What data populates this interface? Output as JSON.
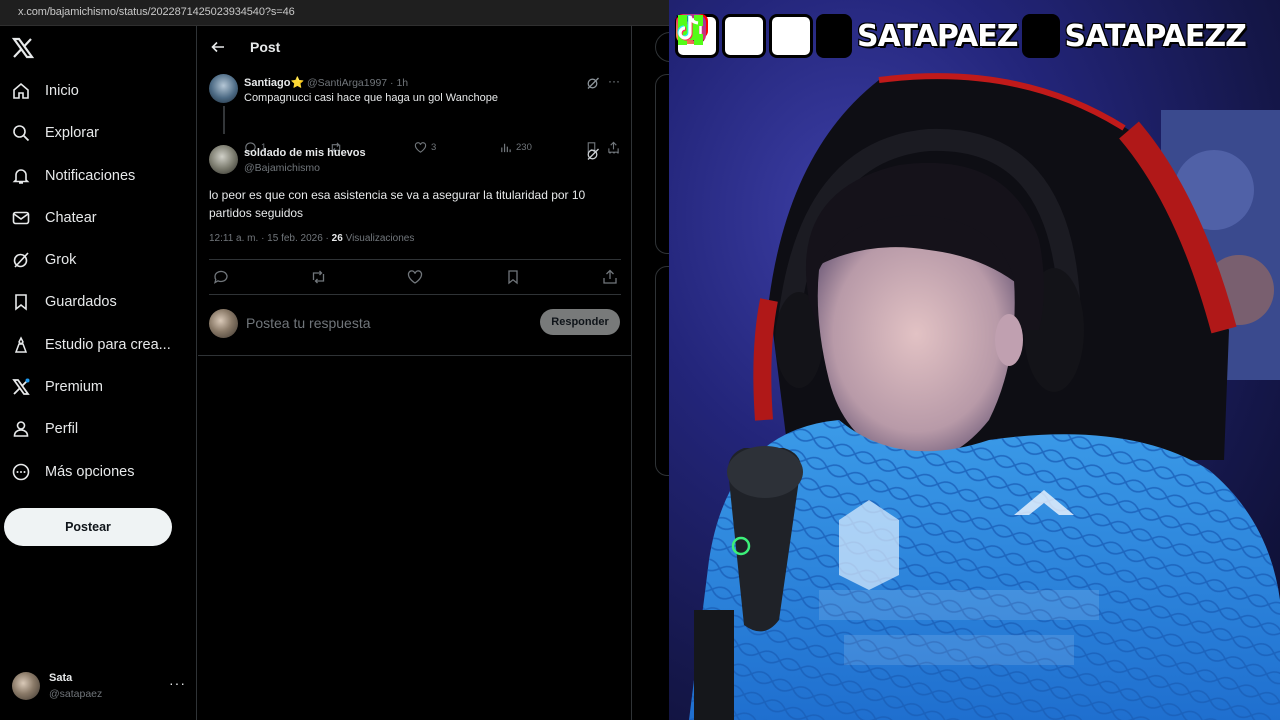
{
  "browser": {
    "url": "x.com/bajamichismo/status/2022871425023934540?s=46"
  },
  "sidebar": {
    "items": [
      {
        "label": "Inicio",
        "icon": "home-icon"
      },
      {
        "label": "Explorar",
        "icon": "search-icon"
      },
      {
        "label": "Notificaciones",
        "icon": "bell-icon"
      },
      {
        "label": "Chatear",
        "icon": "mail-icon"
      },
      {
        "label": "Grok",
        "icon": "grok-icon"
      },
      {
        "label": "Guardados",
        "icon": "bookmark-icon"
      },
      {
        "label": "Estudio para crea...",
        "icon": "studio-icon"
      },
      {
        "label": "Premium",
        "icon": "x-premium-icon"
      },
      {
        "label": "Perfil",
        "icon": "person-icon"
      },
      {
        "label": "Más opciones",
        "icon": "more-circle-icon"
      }
    ],
    "post_button": "Postear",
    "account": {
      "name": "Sata",
      "handle": "@satapaez",
      "more": "···"
    }
  },
  "main": {
    "title": "Post",
    "reply": {
      "name": "Santiago",
      "star": "⭐",
      "meta": "@SantiArga1997 · 1h",
      "text": "Compagnucci casi hace que haga un gol Wanchope",
      "replies": "1",
      "likes": "3",
      "views": "230"
    },
    "post": {
      "name": "soldado de mis huevos",
      "handle": "@Bajamichismo",
      "text": "lo peor es que con esa asistencia se va a asegurar la titularidad por 10 partidos seguidos",
      "timestamp": "12:11 a. m. · 15 feb. 2026 · ",
      "views_count": "26",
      "views_label": " Visualizaciones"
    },
    "compose": {
      "placeholder": "Postea tu respuesta",
      "button": "Responder"
    }
  },
  "overlay": {
    "channel_name_1": "SATAPAEZ",
    "channel_name_2": "SATAPAEZZ",
    "icons": [
      "youtube-icon",
      "instagram-icon",
      "x-icon",
      "kick-icon",
      "tiktok-icon"
    ]
  },
  "colors": {
    "background": "#000000",
    "text": "#e7e9ea",
    "muted": "#71767b",
    "border": "#2f3336",
    "youtube": "#ff0000",
    "kick": "#53fc18"
  }
}
